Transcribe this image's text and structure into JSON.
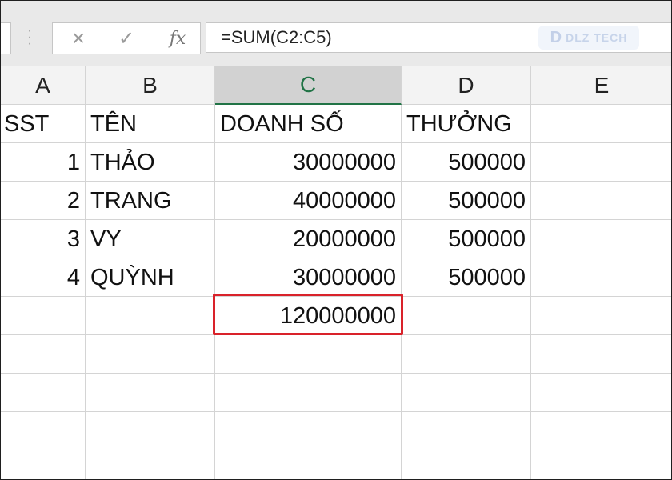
{
  "formula_bar": {
    "cancel_icon": "×",
    "enter_icon": "✓",
    "fx_label": "fx",
    "formula": "=SUM(C2:C5)",
    "logo_text": "DLZ TECH"
  },
  "columns": [
    "A",
    "B",
    "C",
    "D",
    "E"
  ],
  "selected_column": "C",
  "rows": [
    [
      "SST",
      "TÊN",
      "DOANH SỐ",
      "THƯỞNG",
      ""
    ],
    [
      "1",
      "THẢO",
      "30000000",
      "500000",
      ""
    ],
    [
      "2",
      "TRANG",
      "40000000",
      "500000",
      ""
    ],
    [
      "3",
      "VY",
      "20000000",
      "500000",
      ""
    ],
    [
      "4",
      "QUỲNH",
      "30000000",
      "500000",
      ""
    ],
    [
      "",
      "",
      "120000000",
      "",
      ""
    ],
    [
      "",
      "",
      "",
      "",
      ""
    ],
    [
      "",
      "",
      "",
      "",
      ""
    ],
    [
      "",
      "",
      "",
      "",
      ""
    ],
    [
      "",
      "",
      "",
      "",
      ""
    ]
  ],
  "highlight_color": "#d9222a",
  "accent_color": "#217346"
}
